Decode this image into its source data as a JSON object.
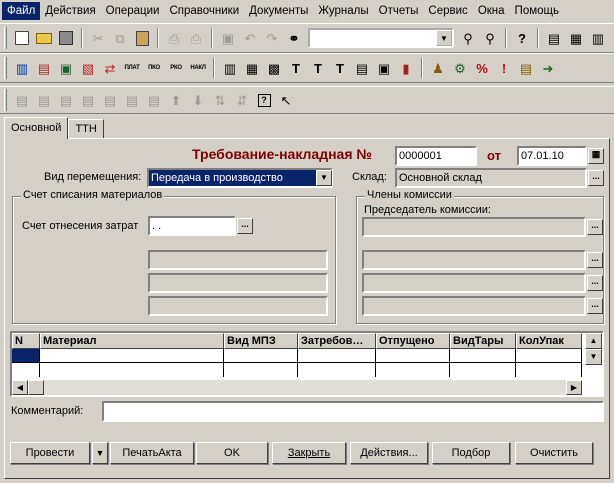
{
  "menu": [
    "Файл",
    "Действия",
    "Операции",
    "Справочники",
    "Документы",
    "Журналы",
    "Отчеты",
    "Сервис",
    "Окна",
    "Помощь"
  ],
  "toolbar1": {
    "search_value": ""
  },
  "toolbar2": {
    "labels": [
      "ПЛАТ",
      "ПКО",
      "РКО",
      "НАКЛ"
    ]
  },
  "tabs": [
    "Основной",
    "ТТН"
  ],
  "doc": {
    "title": "Требование-накладная №",
    "number": "0000001",
    "date_label": "от",
    "date": "07.01.10",
    "movement_label": "Вид перемещения:",
    "movement_value": "Передача в производство",
    "warehouse_label": "Склад:",
    "warehouse_value": "Основной склад"
  },
  "writeoff": {
    "title": "Счет списания материалов",
    "cost_label": "Счет отнесения затрат",
    "cost_value": ". ."
  },
  "commission": {
    "title": "Члены комиссии",
    "chairman_label": "Председатель комиссии:"
  },
  "table": {
    "columns": [
      "N",
      "Материал",
      "Вид МПЗ",
      "Затребов…",
      "Отпущено",
      "ВидТары",
      "КолУпак"
    ]
  },
  "comment": {
    "label": "Комментарий:",
    "value": ""
  },
  "buttons": {
    "post": "Провести",
    "print": "ПечатьАкта",
    "ok": "OK",
    "close": "Закрыть",
    "actions": "Действия...",
    "select": "Подбор",
    "clear": "Очистить"
  },
  "colors": {
    "title": "#800000",
    "selection": "#0a246a",
    "face": "#d4d0c8"
  }
}
